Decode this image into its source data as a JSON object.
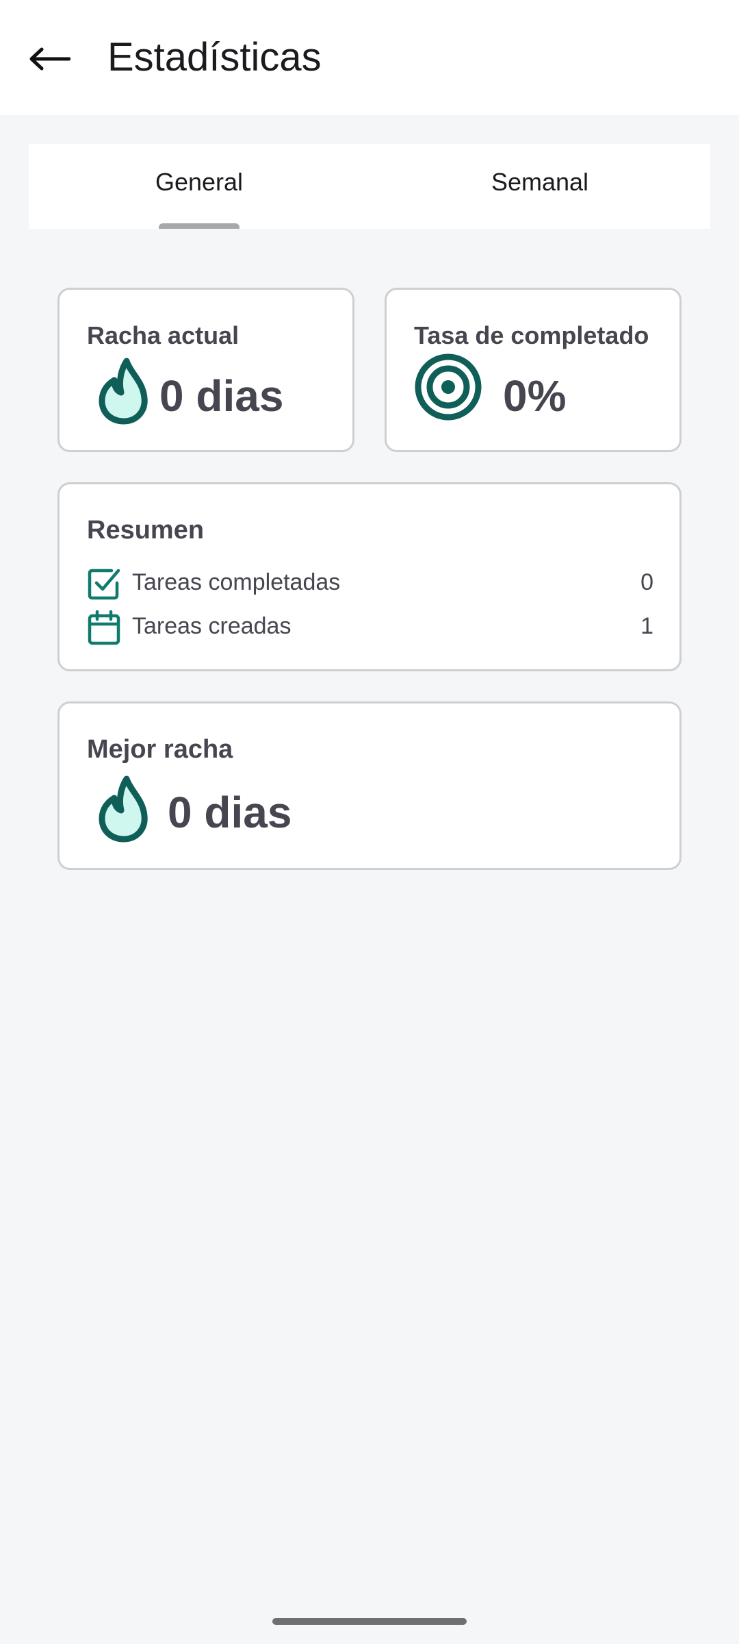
{
  "header": {
    "title": "Estadísticas"
  },
  "tabs": [
    {
      "label": "General",
      "selected": true
    },
    {
      "label": "Semanal",
      "selected": false
    }
  ],
  "streak_card": {
    "label": "Racha actual",
    "value": "0 dias",
    "icon": "flame-icon"
  },
  "completion_card": {
    "label": "Tasa de completado",
    "value": "0%",
    "icon": "target-icon"
  },
  "summary": {
    "title": "Resumen",
    "rows": [
      {
        "label": "Tareas completadas",
        "value": "0",
        "icon": "checkbox-icon"
      },
      {
        "label": "Tareas creadas",
        "value": "1",
        "icon": "calendar-icon"
      }
    ]
  },
  "best_streak_card": {
    "label": "Mejor racha",
    "value": "0 dias",
    "icon": "flame-icon"
  },
  "colors": {
    "accent": "#0f6b63",
    "accent_light": "#cff7ef",
    "background": "#f5f6f8"
  }
}
